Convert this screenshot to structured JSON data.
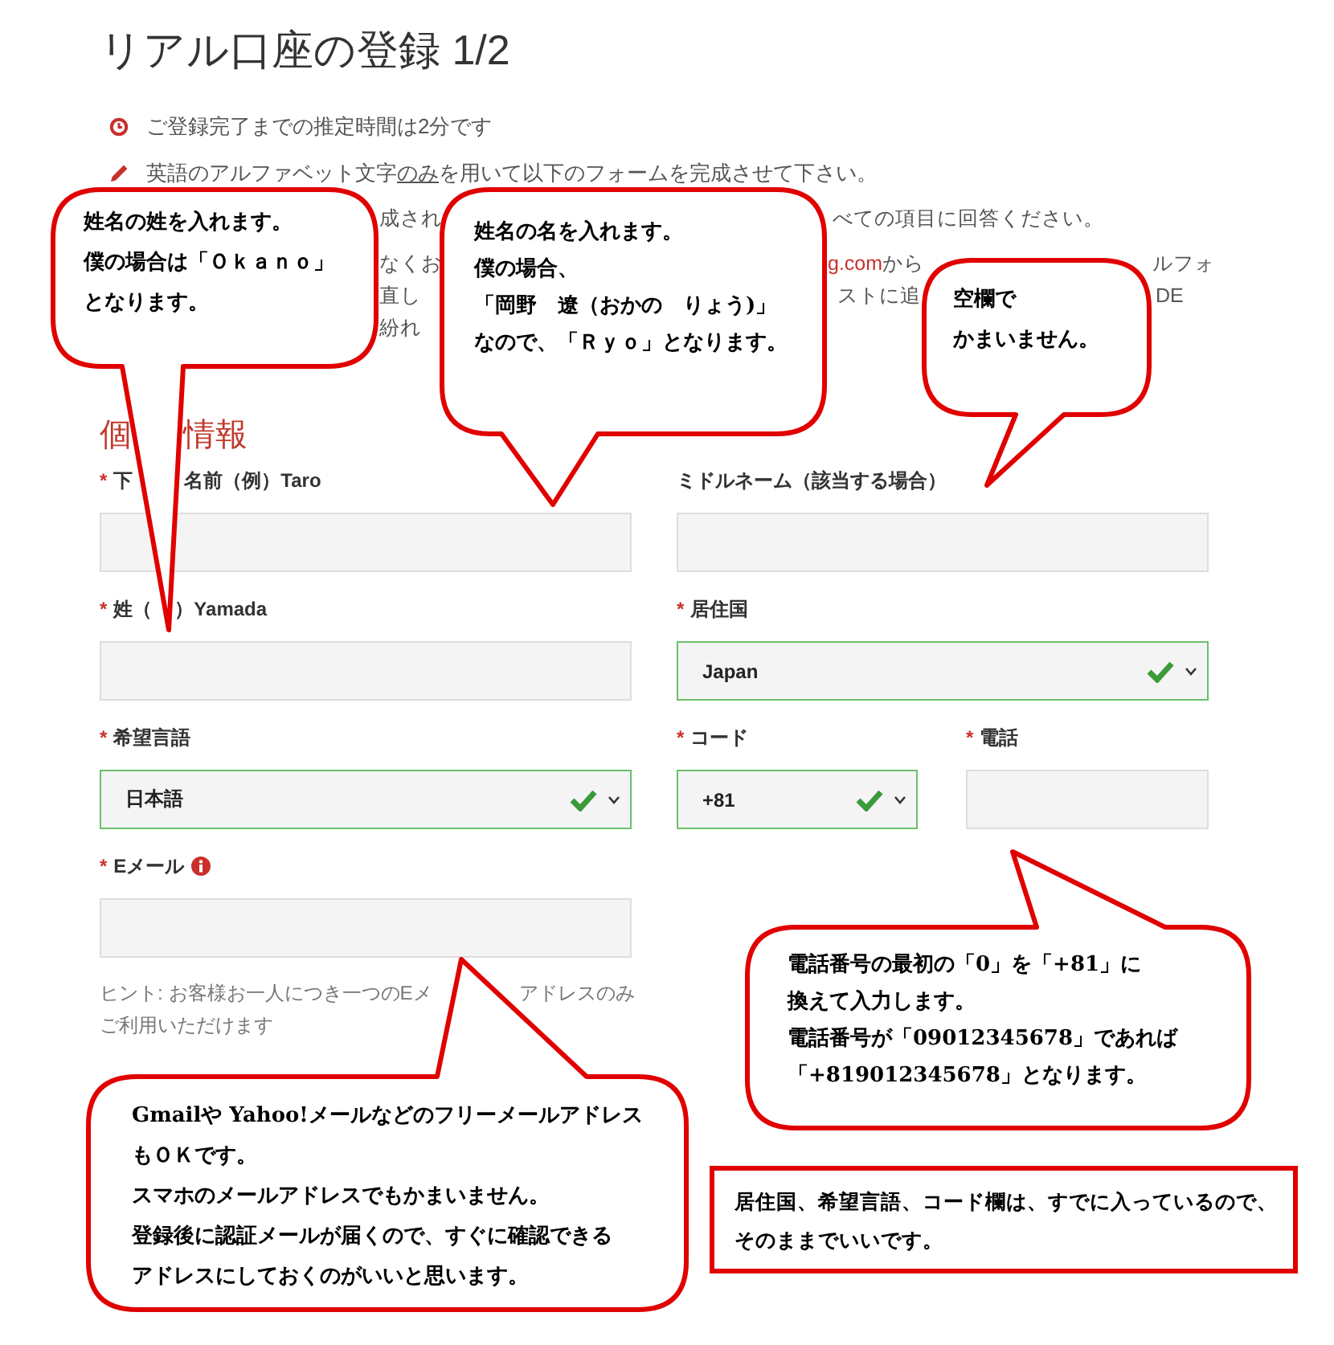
{
  "page": {
    "title": "リアル口座の登録 1/2"
  },
  "notices": [
    {
      "segments": [
        {
          "text": "ご登録完了までの推定時間は2分です",
          "underline": false
        }
      ]
    },
    {
      "segments": [
        {
          "text": "英語のアルファベット文字",
          "underline": false
        },
        {
          "text": "のみ",
          "underline": true
        },
        {
          "text": "を用いて以下のフォームを完成させて下さい。",
          "underline": false
        }
      ]
    }
  ],
  "partly_hidden_lines": [
    [
      {
        "text": "成され",
        "kind": "text"
      },
      {
        "text": "べての項目に回答ください。",
        "kind": "text"
      }
    ],
    [
      {
        "text": "なくお",
        "kind": "text"
      },
      {
        "text": "g.com",
        "kind": "link"
      },
      {
        "text": "から",
        "kind": "text"
      },
      {
        "text": "ルフォ",
        "kind": "text"
      }
    ],
    [
      {
        "text": "直し",
        "kind": "text"
      },
      {
        "text": "ストに追",
        "kind": "text"
      },
      {
        "text": "DE",
        "kind": "text"
      }
    ],
    [
      {
        "text": "紛れ",
        "kind": "text"
      }
    ]
  ],
  "section": {
    "title_parts": [
      "個",
      "情報"
    ]
  },
  "required_mark": "*",
  "fields": [
    {
      "label_parts": [
        "下",
        "名前（例）Taro"
      ],
      "required": true,
      "kind": "text",
      "valid": false,
      "info": false
    },
    {
      "label_parts": [
        "ミドルネーム（該当する場合）"
      ],
      "required": false,
      "kind": "text",
      "valid": false,
      "info": false
    },
    {
      "label_parts": [
        "姓（",
        "）Yamada"
      ],
      "required": true,
      "kind": "text",
      "valid": false,
      "info": false
    },
    {
      "label_parts": [
        "居住国"
      ],
      "required": true,
      "kind": "select",
      "value": "Japan",
      "valid": true,
      "info": false
    },
    {
      "label_parts": [
        "希望言語"
      ],
      "required": true,
      "kind": "select",
      "value": "日本語",
      "valid": true,
      "info": false
    },
    {
      "label_parts": [
        "コード"
      ],
      "required": true,
      "kind": "select",
      "value": "+81",
      "valid": true,
      "info": false
    },
    {
      "label_parts": [
        "電話"
      ],
      "required": true,
      "kind": "text",
      "valid": false,
      "info": false
    },
    {
      "label_parts": [
        "Eメール"
      ],
      "required": true,
      "kind": "text",
      "valid": false,
      "info": true
    }
  ],
  "hint_lines": [
    [
      "ヒント: お客様お一人につき一つのEメ",
      "アドレスのみ"
    ],
    [
      "ご利用いただけます"
    ]
  ],
  "callouts": [
    {
      "kind": "bubble",
      "lines": [
        "姓名の姓を入れます。",
        "僕の場合は「Ｏｋａｎｏ」",
        "となります。"
      ]
    },
    {
      "kind": "bubble",
      "lines": [
        "姓名の名を入れます。",
        "僕の場合、",
        "「岡野　遼（おかの　りょう)」",
        "なので、「Ｒｙｏ」となります。"
      ]
    },
    {
      "kind": "bubble",
      "lines": [
        "空欄で",
        "かまいません。"
      ]
    },
    {
      "kind": "bubble",
      "lines": [
        "電話番号の最初の「0」を「+81」に",
        "換えて入力します。",
        "電話番号が「09012345678」であれば",
        "「+819012345678」となります。"
      ]
    },
    {
      "kind": "bubble",
      "lines": [
        "Gmailや Yahoo!メールなどのフリーメールアドレス",
        "もＯＫです。",
        "スマホのメールアドレスでもかまいません。",
        "登録後に認証メールが届くので、すぐに確認できる",
        "アドレスにしておくのがいいと思います。"
      ]
    },
    {
      "kind": "box",
      "lines": [
        "居住国、希望言語、コード欄は、すでに入っているので、",
        "そのままでいいです。"
      ]
    }
  ]
}
